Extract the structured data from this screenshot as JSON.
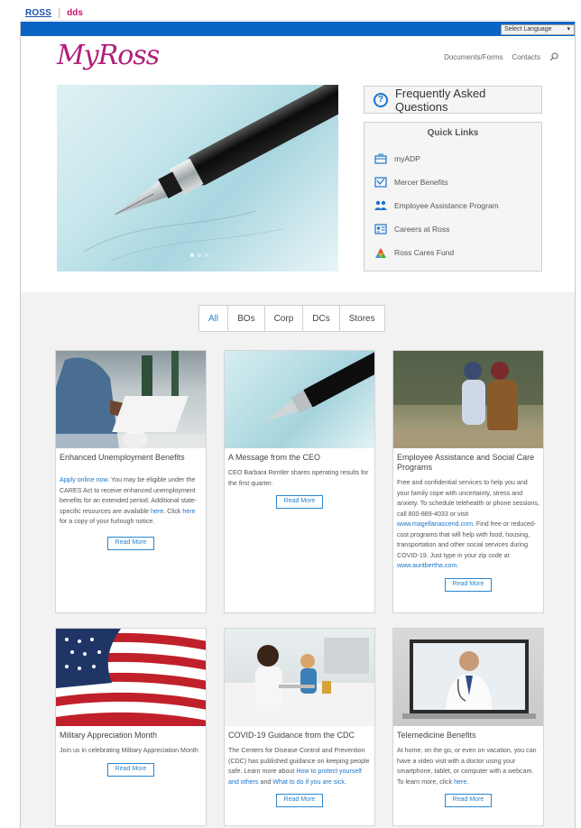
{
  "brand": {
    "ross": "ROSS",
    "dds": "dds"
  },
  "language": {
    "select_label": "Select Language",
    "arrow": "▾"
  },
  "header": {
    "logo": "MyRoss",
    "nav": [
      "Documents/Forms",
      "Contacts"
    ]
  },
  "faq": {
    "label": "Frequently Asked Questions"
  },
  "quick_links": {
    "title": "Quick Links",
    "items": [
      {
        "label": "myADP",
        "icon": "briefcase-icon"
      },
      {
        "label": "Mercer Benefits",
        "icon": "checklist-icon"
      },
      {
        "label": "Employee Assistance Program",
        "icon": "people-icon"
      },
      {
        "label": "Careers at Ross",
        "icon": "id-card-icon"
      },
      {
        "label": "Ross Cares Fund",
        "icon": "triangle-logo-icon"
      }
    ]
  },
  "filters": [
    "All",
    "BOs",
    "Corp",
    "DCs",
    "Stores"
  ],
  "cards": [
    {
      "title": "Enhanced Unemployment Benefits",
      "body_link1": "Apply online now.",
      "body_text1": " You may be eligible under the CARES Act to receive enhanced unemployment benefits for an extended period. Additional state-specific resources are available ",
      "body_link2": "here",
      "body_text2": ". Click ",
      "body_link3": "here",
      "body_text3": " for a copy of your furlough notice.",
      "button": "Read More"
    },
    {
      "title": "A Message from the CEO",
      "body": "CEO Barbara Rentler shares operating results for the first quarter.",
      "button": "Read More"
    },
    {
      "title": "Employee Assistance and Social Care Programs",
      "body_text1": "Free and confidential services to help you and your family cope with uncertainty, stress and anxiety. To schedule telehealth or phone sessions, call 800-889-4033 or visit ",
      "body_link1": "www.magellanascend.com",
      "body_text2": ". Find free or reduced-cost programs that will help with food, housing, transportation and other social services during COVID-19. Just type in your zip code at ",
      "body_link2": "www.auntbertha.com",
      "body_text3": ".",
      "button": "Read More"
    },
    {
      "title": "Military Appreciation Month",
      "body": "Join us in celebrating Military Appreciation Month",
      "button": "Read More"
    },
    {
      "title": "COVID-19 Guidance from the CDC",
      "body_text1": "The Centers for Disease Control and Prevention (CDC) has published guidance on keeping people safe. Learn more about ",
      "body_link1": "How to protect yourself and others",
      "body_text2": " and ",
      "body_link2": "What to do if you are sick",
      "body_text3": ".",
      "button": "Read More"
    },
    {
      "title": "Telemedicine Benefits",
      "body_text1": "At home, on the go, or even on vacation, you can have a video visit with a doctor using your smartphone, tablet, or computer with a webcam. To learn more, click ",
      "body_link1": "here",
      "body_text2": ".",
      "button": "Read More"
    }
  ],
  "colors": {
    "brand_blue": "#0a64c4",
    "logo_magenta": "#b01e7a",
    "link_blue": "#1b75c8"
  }
}
